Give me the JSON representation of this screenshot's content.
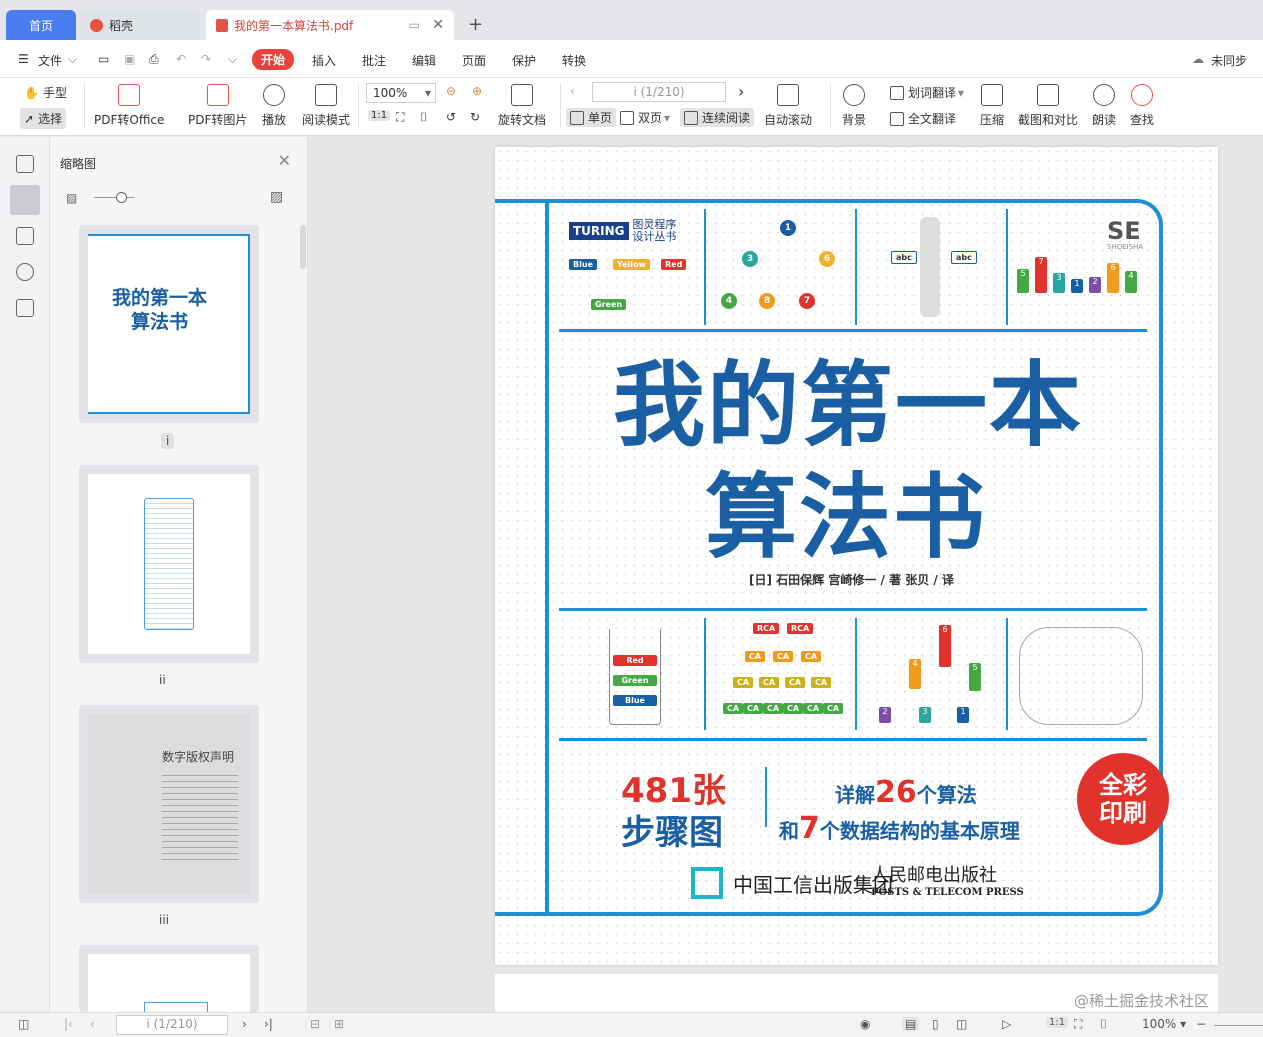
{
  "tabs": {
    "home": "首页",
    "docer": "稻壳",
    "pdf": "我的第一本算法书.pdf"
  },
  "menu": {
    "file": "文件",
    "start": "开始",
    "insert": "插入",
    "annotate": "批注",
    "edit": "编辑",
    "page": "页面",
    "protect": "保护",
    "convert": "转换",
    "sync": "未同步"
  },
  "toolbar": {
    "hand": "手型",
    "select": "选择",
    "pdf_to_office": "PDF转Office",
    "pdf_to_image": "PDF转图片",
    "play": "播放",
    "read_mode": "阅读模式",
    "zoom": "100%",
    "rotate": "旋转文档",
    "page_input": "i (1/210)",
    "single": "单页",
    "double": "双页",
    "continuous": "连续阅读",
    "auto_scroll": "自动滚动",
    "background": "背景",
    "word_translate": "划词翻译",
    "full_translate": "全文翻译",
    "compress": "压缩",
    "screenshot": "截图和对比",
    "read_aloud": "朗读",
    "search": "查找",
    "fit_page": "1:1"
  },
  "thumbnails": {
    "title": "缩略图",
    "labels": [
      "i",
      "ii",
      "iii"
    ],
    "copyright_title": "数字版权声明",
    "mini_title": "我的第一本\n算法书"
  },
  "cover": {
    "series_logo": "TURING",
    "series": "图灵程序\n设计丛书",
    "title_line1": "我的第一本",
    "title_line2": "算法书",
    "authors": "[日] 石田保辉  宫崎修一 / 著    张贝 / 译",
    "steps_count": "481张",
    "steps_label": "步骤图",
    "detail1_pre": "详解",
    "detail1_num": "26",
    "detail1_post": "个算法",
    "detail2_pre": "和",
    "detail2_num": "7",
    "detail2_post": "个数据结构的基本原理",
    "badge_line1": "全彩",
    "badge_line2": "印刷",
    "publisher1": "中国工信出版集团",
    "publisher2_cn": "人民邮电出版社",
    "publisher2_en": "POSTS & TELECOM PRESS",
    "se_logo": "SE",
    "se_sub": "SHOEISHA",
    "tags": [
      "Blue",
      "Yellow",
      "Red",
      "Green"
    ],
    "stack": [
      "Red",
      "Green",
      "Blue"
    ],
    "bars": [
      "5",
      "7",
      "3",
      "1",
      "2",
      "6",
      "4"
    ],
    "tree_top": [
      "1",
      "3",
      "6",
      "4",
      "8",
      "7"
    ],
    "tree_bottom": [
      "6",
      "4",
      "5",
      "2",
      "3",
      "1"
    ],
    "rca": "RCA",
    "ca": "CA",
    "abc": "abc"
  },
  "status": {
    "page": "i (1/210)",
    "zoom": "100%"
  },
  "watermark": "@稀土掘金技术社区"
}
